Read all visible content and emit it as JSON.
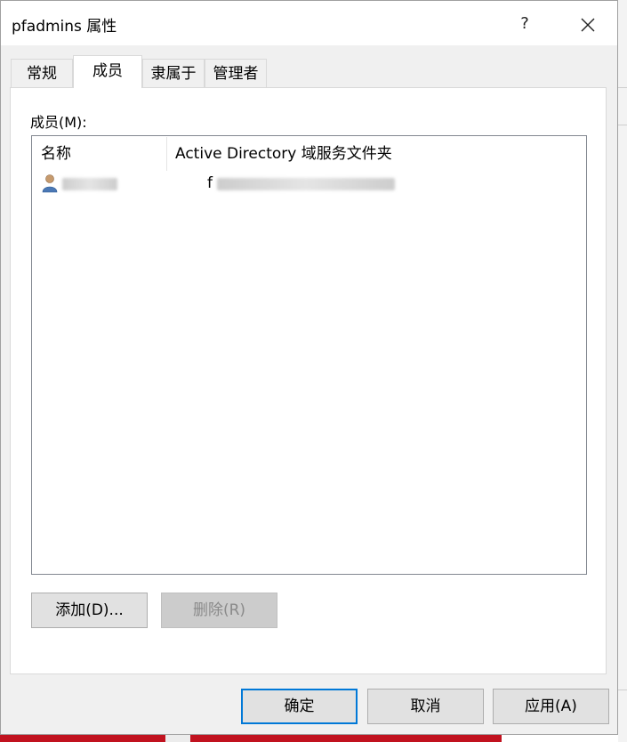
{
  "window": {
    "title": "pfadmins 属性",
    "help_label": "?",
    "close_icon": "close-icon"
  },
  "tabs": [
    {
      "label": "常规",
      "active": false
    },
    {
      "label": "成员",
      "active": true
    },
    {
      "label": "隶属于",
      "active": false
    },
    {
      "label": "管理者",
      "active": false
    }
  ],
  "members": {
    "label": "成员(M):",
    "columns": [
      "名称",
      "Active Directory 域服务文件夹"
    ],
    "rows": [
      {
        "icon": "user-icon",
        "name": "",
        "folder_prefix": "f",
        "redacted": true
      }
    ]
  },
  "buttons": {
    "add": "添加(D)...",
    "remove": "删除(R)",
    "ok": "确定",
    "cancel": "取消",
    "apply": "应用(A)"
  },
  "colors": {
    "accent": "#0078d7",
    "background_bar": "#c1121f"
  }
}
